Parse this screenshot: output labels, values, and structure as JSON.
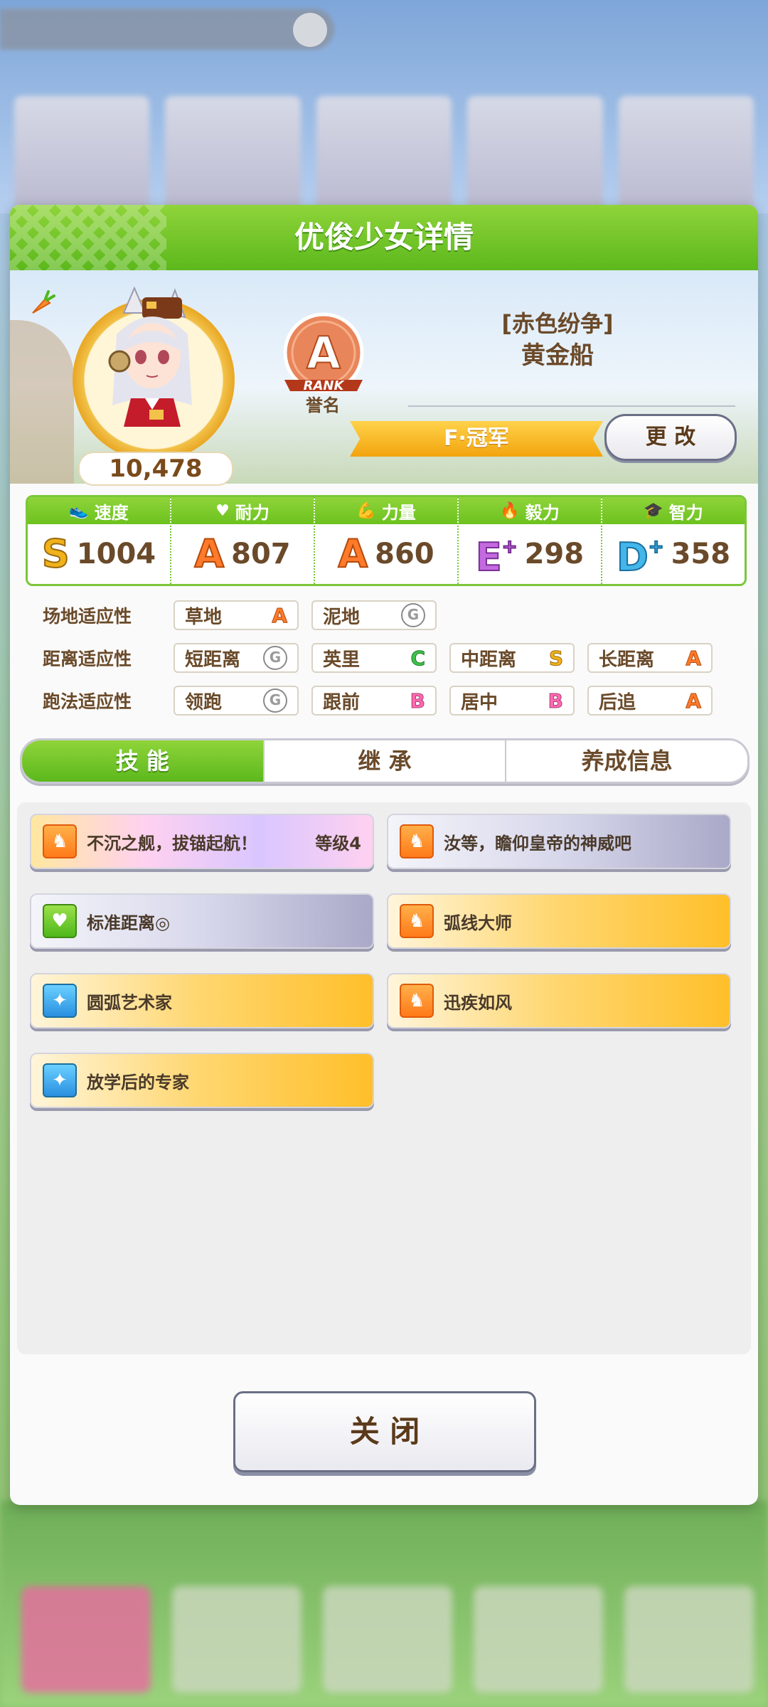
{
  "modal": {
    "title": "优俊少女详情"
  },
  "profile": {
    "score": "10,478",
    "rank_letter": "A",
    "rank_word": "RANK",
    "rank_label": "誉名",
    "char_title": "[赤色纷争]",
    "char_name": "黄金船",
    "title_ribbon": "F·冠军",
    "change_label": "更 改"
  },
  "stats": [
    {
      "label": "速度",
      "icon": "shoe-icon",
      "grade": "S",
      "plus": "",
      "value": "1004"
    },
    {
      "label": "耐力",
      "icon": "heart-icon",
      "grade": "A",
      "plus": "",
      "value": "807"
    },
    {
      "label": "力量",
      "icon": "muscle-icon",
      "grade": "A",
      "plus": "",
      "value": "860"
    },
    {
      "label": "毅力",
      "icon": "flame-icon",
      "grade": "E",
      "plus": "+",
      "value": "298"
    },
    {
      "label": "智力",
      "icon": "graduation-cap-icon",
      "grade": "D",
      "plus": "+",
      "value": "358"
    }
  ],
  "aptitude": {
    "track": {
      "label": "场地适应性",
      "items": [
        {
          "name": "草地",
          "grade": "A"
        },
        {
          "name": "泥地",
          "grade": "G"
        }
      ]
    },
    "distance": {
      "label": "距离适应性",
      "items": [
        {
          "name": "短距离",
          "grade": "G"
        },
        {
          "name": "英里",
          "grade": "C"
        },
        {
          "name": "中距离",
          "grade": "S"
        },
        {
          "name": "长距离",
          "grade": "A"
        }
      ]
    },
    "style": {
      "label": "跑法适应性",
      "items": [
        {
          "name": "领跑",
          "grade": "G"
        },
        {
          "name": "跟前",
          "grade": "B"
        },
        {
          "name": "居中",
          "grade": "B"
        },
        {
          "name": "后追",
          "grade": "A"
        }
      ]
    }
  },
  "tabs": [
    "技 能",
    "继 承",
    "养成信息"
  ],
  "skills": [
    {
      "name": "不沉之舰，拔锚起航！",
      "level": "等级4",
      "style": "rainbow",
      "icon": "lion-emblem-icon"
    },
    {
      "name": "汝等，瞻仰皇帝的神威吧",
      "level": "",
      "style": "purple",
      "icon": "lion-emblem-icon"
    },
    {
      "name": "标准距离◎",
      "level": "",
      "style": "purple",
      "icon": "heart-icon"
    },
    {
      "name": "弧线大师",
      "level": "",
      "style": "gold",
      "icon": "lion-emblem-icon"
    },
    {
      "name": "圆弧艺术家",
      "level": "",
      "style": "gold",
      "icon": "sparkle-icon"
    },
    {
      "name": "迅疾如风",
      "level": "",
      "style": "gold",
      "icon": "lion-emblem-icon"
    },
    {
      "name": "放学后的专家",
      "level": "",
      "style": "gold",
      "icon": "sparkle-icon"
    }
  ],
  "close_label": "关 闭"
}
